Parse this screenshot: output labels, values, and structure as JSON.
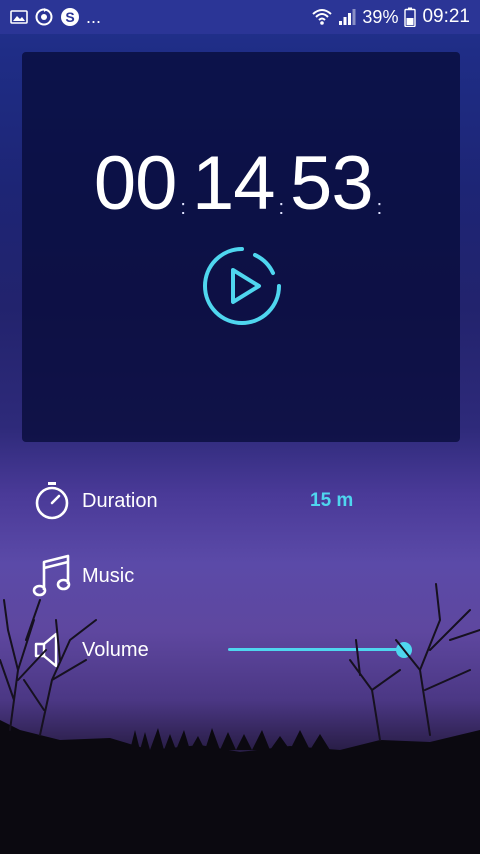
{
  "status_bar": {
    "notification_icons": [
      "image-icon",
      "sync-icon",
      "skype-icon"
    ],
    "overflow": "...",
    "battery_percent": "39%",
    "time": "09:21"
  },
  "timer": {
    "hours": "00",
    "minutes": "14",
    "seconds": "53",
    "separator": ":",
    "play_icon": "play-circle-icon"
  },
  "settings": {
    "duration": {
      "label": "Duration",
      "value": "15 m",
      "icon": "timer-icon"
    },
    "music": {
      "label": "Music",
      "icon": "music-note-icon"
    },
    "volume": {
      "label": "Volume",
      "icon": "speaker-icon",
      "level": 1.0
    }
  },
  "colors": {
    "accent": "#4fd6ef",
    "status_bar": "#2b3596",
    "card": "#080c3a"
  }
}
